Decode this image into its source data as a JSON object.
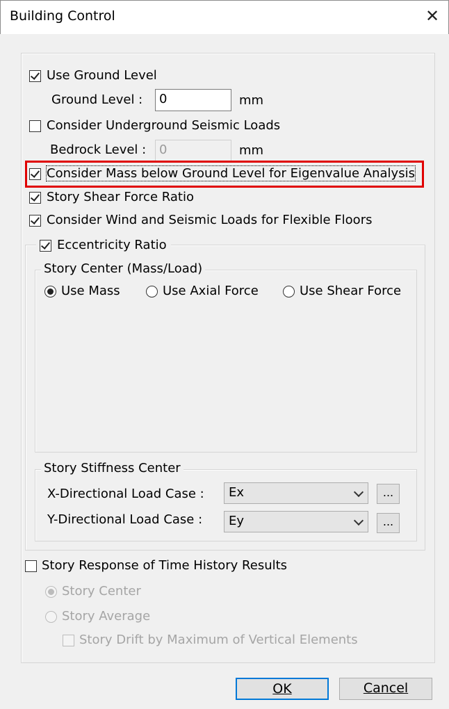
{
  "window": {
    "title": "Building Control",
    "close_glyph": "✕"
  },
  "ground": {
    "use_ground_level": {
      "label": "Use Ground Level",
      "checked": true
    },
    "ground_level_label": "Ground Level  :",
    "ground_level_value": "0",
    "ground_level_unit": "mm",
    "consider_underground": {
      "label": "Consider Underground Seismic Loads",
      "checked": false
    },
    "bedrock_level_label": "Bedrock Level :",
    "bedrock_level_value": "0",
    "bedrock_level_unit": "mm"
  },
  "options": {
    "consider_mass_below_ground": {
      "label": "Consider Mass below Ground Level for Eigenvalue Analysis",
      "checked": true,
      "highlighted": true,
      "highlight_color": "#e00000"
    },
    "story_shear_force_ratio": {
      "label": "Story Shear Force Ratio",
      "checked": true
    },
    "consider_wind_seismic_flexible": {
      "label": "Consider Wind and Seismic Loads for Flexible Floors",
      "checked": true
    }
  },
  "eccentricity": {
    "label": "Eccentricity Ratio",
    "checked": true,
    "story_center": {
      "legend": "Story Center (Mass/Load)",
      "options": [
        "Use Mass",
        "Use Axial Force",
        "Use Shear Force"
      ],
      "selected": "Use Mass"
    },
    "stiffness_center": {
      "legend": "Story Stiffness Center",
      "x_label": "X-Directional Load Case :",
      "x_value": "Ex",
      "y_label": "Y-Directional Load Case :",
      "y_value": "Ey",
      "browse_label": "..."
    }
  },
  "time_history": {
    "label": "Story Response of Time History Results",
    "checked": false,
    "story_center": "Story Center",
    "story_average": "Story Average",
    "story_drift": "Story Drift by Maximum of Vertical Elements"
  },
  "buttons": {
    "ok": "OK",
    "cancel": "Cancel"
  },
  "colors": {
    "accent": "#0078d7",
    "disabled_text": "#a5a5a5"
  }
}
